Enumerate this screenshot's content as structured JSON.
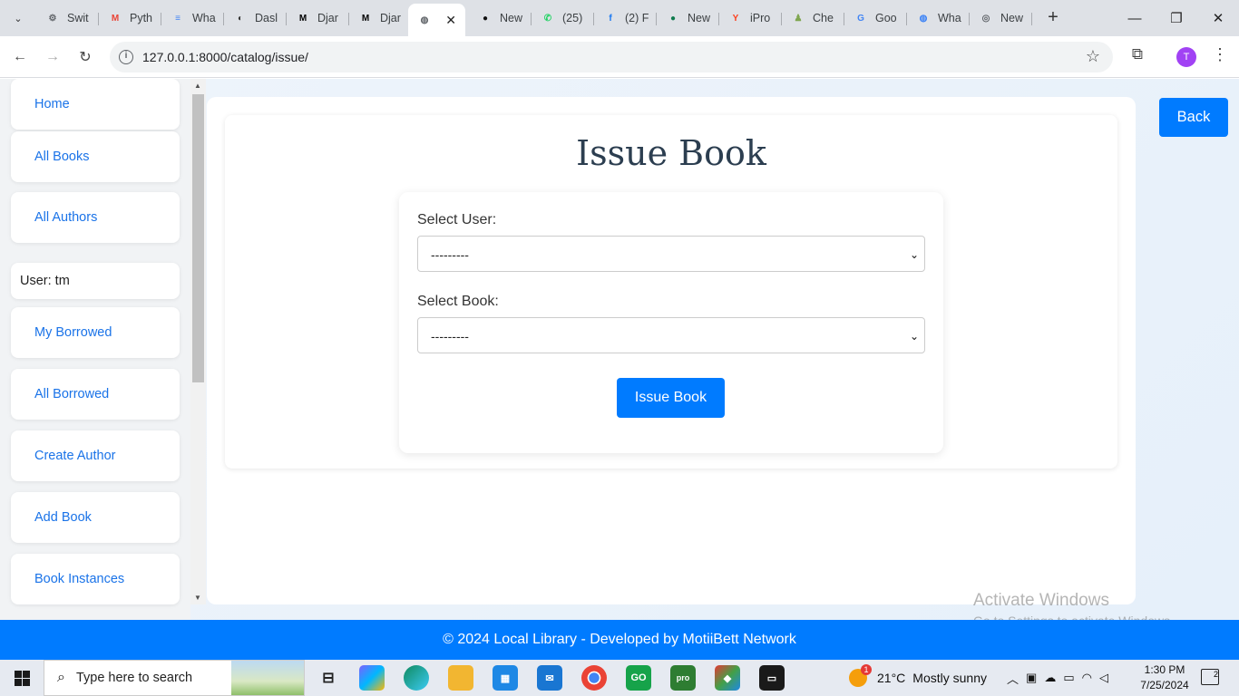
{
  "browser": {
    "tabs": [
      {
        "label": "Swit",
        "icon": "settings-icon",
        "color": "#5f6368"
      },
      {
        "label": "Pyth",
        "icon": "gmail-icon",
        "color": "#ea4335"
      },
      {
        "label": "Wha",
        "icon": "docs-icon",
        "color": "#4285f4"
      },
      {
        "label": "Dasl",
        "icon": "dashboard-icon",
        "color": "#333333"
      },
      {
        "label": "Djar",
        "icon": "medium-icon",
        "color": "#000000"
      },
      {
        "label": "Djar",
        "icon": "medium-icon",
        "color": "#000000"
      },
      {
        "label": "",
        "icon": "globe-icon",
        "color": "#5f6368",
        "active": true
      },
      {
        "label": "New",
        "icon": "github-icon",
        "color": "#111111"
      },
      {
        "label": "(25)",
        "icon": "whatsapp-icon",
        "color": "#25d366"
      },
      {
        "label": "(2) F",
        "icon": "facebook-icon",
        "color": "#1877f2"
      },
      {
        "label": "New",
        "icon": "chat-icon",
        "color": "#0f7b4e"
      },
      {
        "label": "iPro",
        "icon": "yandex-icon",
        "color": "#fc3f1d"
      },
      {
        "label": "Che",
        "icon": "chess-icon",
        "color": "#7fa650"
      },
      {
        "label": "Goo",
        "icon": "google-icon",
        "color": "#4285f4"
      },
      {
        "label": "Wha",
        "icon": "globe-icon",
        "color": "#3b82f6"
      },
      {
        "label": "New",
        "icon": "chrome-icon",
        "color": "#5f6368"
      }
    ],
    "url": "127.0.0.1:8000/catalog/issue/",
    "profile_initial": "T"
  },
  "sidebar": {
    "items": [
      {
        "label": "Home"
      },
      {
        "label": "All Books"
      },
      {
        "label": "All Authors"
      },
      {
        "label": "User: tm",
        "static": true
      },
      {
        "label": "My Borrowed"
      },
      {
        "label": "All Borrowed"
      },
      {
        "label": "Create Author"
      },
      {
        "label": "Add Book"
      },
      {
        "label": "Book Instances"
      }
    ]
  },
  "main": {
    "title": "Issue Book",
    "user_label": "Select User:",
    "user_value": "---------",
    "book_label": "Select Book:",
    "book_value": "---------",
    "submit_label": "Issue Book",
    "back_label": "Back"
  },
  "watermark": {
    "line1": "Activate Windows",
    "line2": "Go to Settings to activate Windows."
  },
  "footer": {
    "text": "© 2024 Local Library - Developed by MotiiBett Network"
  },
  "taskbar": {
    "search_placeholder": "Type here to search",
    "weather_temp": "21°C",
    "weather_text": "Mostly sunny",
    "weather_badge": "1",
    "time": "1:30 PM",
    "date": "7/25/2024",
    "notifications": "2"
  },
  "colors": {
    "primary": "#007bff",
    "link": "#1a73e8"
  }
}
